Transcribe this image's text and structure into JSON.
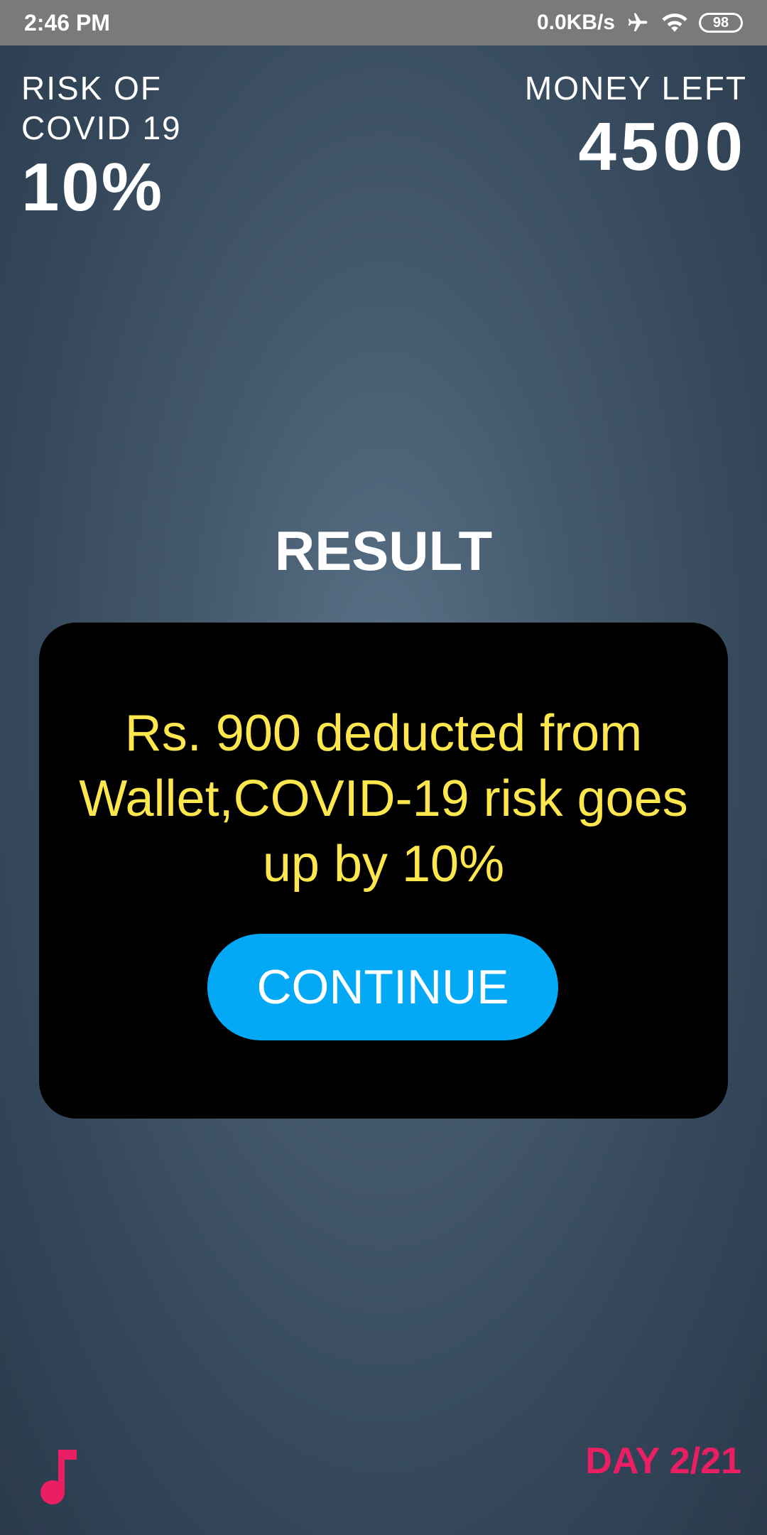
{
  "status_bar": {
    "time": "2:46 PM",
    "network_speed": "0.0KB/s",
    "battery": "98",
    "icons": [
      "airplane-icon",
      "wifi-icon",
      "battery-icon"
    ]
  },
  "hud": {
    "risk_label_line1": "RISK OF",
    "risk_label_line2": "COVID 19",
    "risk_value": "10%",
    "money_label": "MONEY LEFT",
    "money_value": "4500"
  },
  "result": {
    "title": "RESULT",
    "message": "Rs. 900 deducted from Wallet,COVID-19 risk goes up by 10%",
    "continue_label": "CONTINUE"
  },
  "footer": {
    "music_icon": "music-note-icon",
    "day_label": "DAY 2/21"
  },
  "colors": {
    "message": "#fde74c",
    "button": "#03a9f4",
    "accent": "#e91e63",
    "card": "#000000"
  }
}
